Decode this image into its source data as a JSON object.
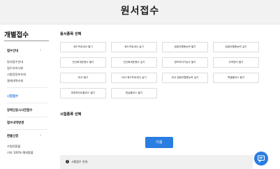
{
  "header": {
    "title": "원서접수"
  },
  "sidebar": {
    "title": "개별접수",
    "groups": [
      {
        "label": "접수안내",
        "items": [
          "원서접수안내",
          "접수유의사항",
          "시험장정보조회",
          "결제내역조회"
        ]
      },
      {
        "label": "시험접수"
      },
      {
        "label": "장애인응시사전접수"
      },
      {
        "label": "접수내역변경"
      },
      {
        "label": "환불신청",
        "items": [
          "수험료환불",
          "기타 100% 예외환불"
        ]
      }
    ]
  },
  "main": {
    "exam_section_title": "응시종목 선택",
    "exams": [
      "워드프로세서 필기",
      "워드프로세서 실기",
      "컴퓨터활용능력 필기",
      "컴퓨터활용능력 실기",
      "전산회계운용사 필기",
      "전산회계운용사 실기",
      "정보처리기능사 필기",
      "무역영어 필기",
      "비서 필기",
      "비서 워드프로세서 실기",
      "비서 컴퓨터활용능력 실기",
      "맥셀플러스 필기",
      "파워포인트플러스 필기",
      "한글플러스 필기"
    ],
    "type_section_title": "시험종류 선택",
    "next_label": "다음",
    "info_label": "시험접수 안내"
  },
  "colors": {
    "accent": "#2a7de1"
  },
  "icons": {
    "group_chevron": "chevron-right-icon",
    "info": "info-icon",
    "chat": "chat-icon"
  }
}
